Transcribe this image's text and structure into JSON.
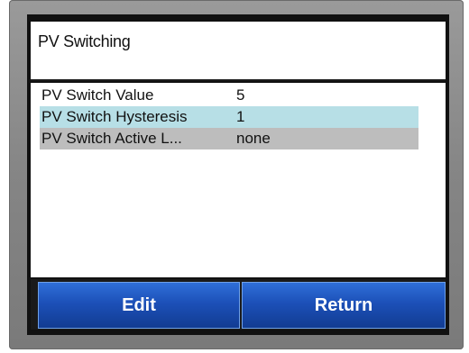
{
  "screen": {
    "title": "PV Switching"
  },
  "list": {
    "items": [
      {
        "name": "PV Switch Value",
        "value": "5"
      },
      {
        "name": "PV Switch Hysteresis",
        "value": "1"
      },
      {
        "name": "PV Switch Active L...",
        "value": "none"
      }
    ],
    "row_colors": [
      "#ffffff",
      "#b7dfe6",
      "#bdbdbd"
    ]
  },
  "buttons": {
    "edit_label": "Edit",
    "return_label": "Return"
  },
  "colors": {
    "button_blue": "#1c50b8",
    "bezel_gray": "#858585"
  }
}
